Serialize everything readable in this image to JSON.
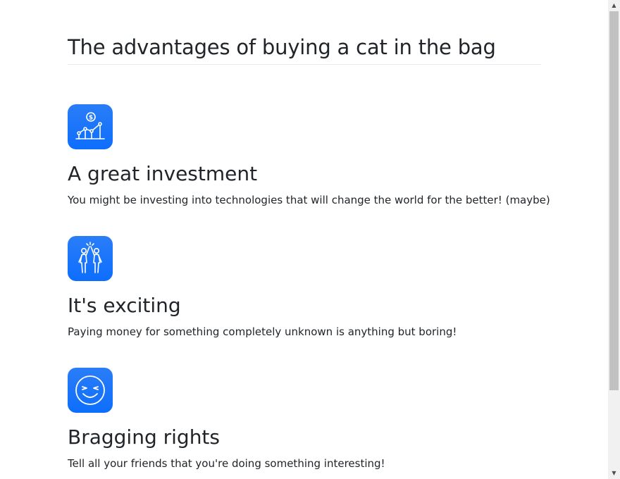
{
  "page": {
    "title": "The advantages of buying a cat in the bag"
  },
  "features": [
    {
      "icon": "investment-chart-icon",
      "heading": "A great investment",
      "text": "You might be investing into technologies that will change the world for the better! (maybe)"
    },
    {
      "icon": "high-five-icon",
      "heading": "It's exciting",
      "text": "Paying money for something completely unknown is anything but boring!"
    },
    {
      "icon": "smiley-face-icon",
      "heading": "Bragging rights",
      "text": "Tell all your friends that you're doing something interesting!"
    }
  ],
  "scrollbar": {
    "up_arrow": "▲",
    "down_arrow": "▼"
  },
  "colors": {
    "accent": "#0d6efd",
    "text": "#212529"
  }
}
